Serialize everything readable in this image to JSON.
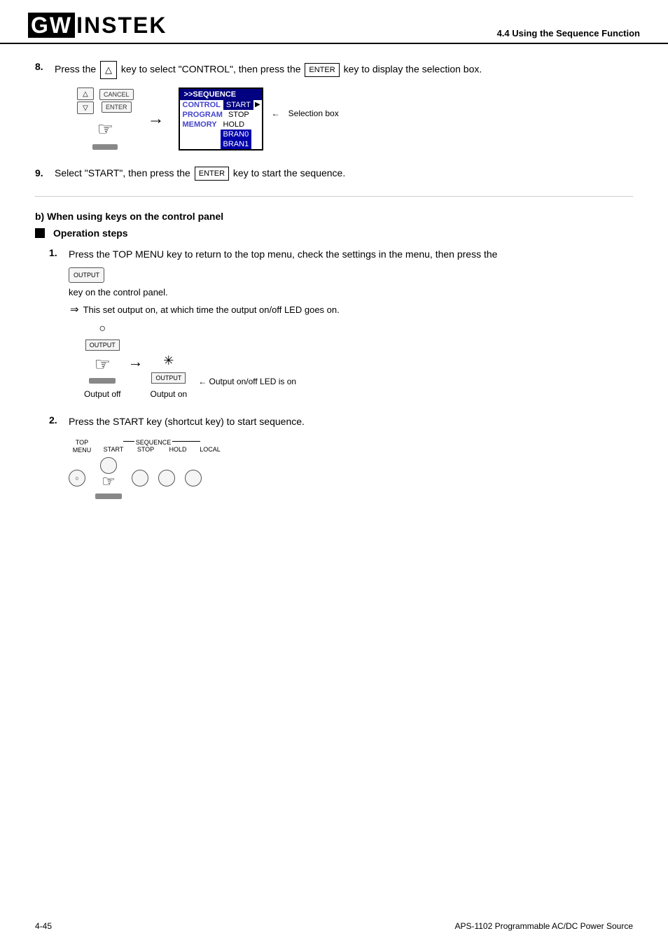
{
  "header": {
    "logo_gw": "GW",
    "logo_instek": "INSTEK",
    "section_title": "4.4 Using the Sequence Function"
  },
  "steps": {
    "step8": {
      "num": "8.",
      "text_before": "Press the",
      "key_up": "△",
      "text_middle": "key to select \"CONTROL\", then press the",
      "key_enter": "ENTER",
      "text_after": "key to display the selection box."
    },
    "step9": {
      "num": "9.",
      "text_before": "Select \"START\", then press the",
      "key_enter": "ENTER",
      "text_after": "key to start the sequence."
    }
  },
  "seq_popup": {
    "title": ">>SEQUENCE",
    "rows": [
      {
        "left": "CONTROL",
        "right": "START",
        "right_selected": true
      },
      {
        "left": "PROGRAM",
        "right": "STOP",
        "right_selected": false
      },
      {
        "left": "MEMORY",
        "right": "HOLD",
        "right_selected": false
      },
      {
        "left": "",
        "right": "BRAN0",
        "right_selected": false
      },
      {
        "left": "",
        "right": "BRAN1",
        "right_selected": false
      }
    ]
  },
  "selection_box_label": "Selection box",
  "section_b": {
    "title": "b) When using keys on the control panel"
  },
  "operation_steps": {
    "title": "Operation steps"
  },
  "op_step1": {
    "num": "1.",
    "text1": "Press the TOP MENU key to return to the top menu, check the settings in the menu, then press the",
    "key_output": "OUTPUT",
    "text2": "key on the control panel.",
    "implies_text": "This set output on, at which time the output on/off LED goes on."
  },
  "op_step2": {
    "num": "2.",
    "text1": "Press the START key (shortcut key) to start sequence."
  },
  "led_diagram": {
    "output_off_label": "Output off",
    "output_on_label": "Output on",
    "led_label": "Output on/off LED is on",
    "key_output": "OUTPUT"
  },
  "seq_keys": {
    "top_menu_label": "TOP\nMENU",
    "sequence_label": "SEQUENCE",
    "start_label": "START",
    "stop_label": "STOP",
    "hold_label": "HOLD",
    "local_label": "LOCAL"
  },
  "footer": {
    "page": "4-45",
    "title": "APS-1102 Programmable AC/DC Power Source"
  }
}
